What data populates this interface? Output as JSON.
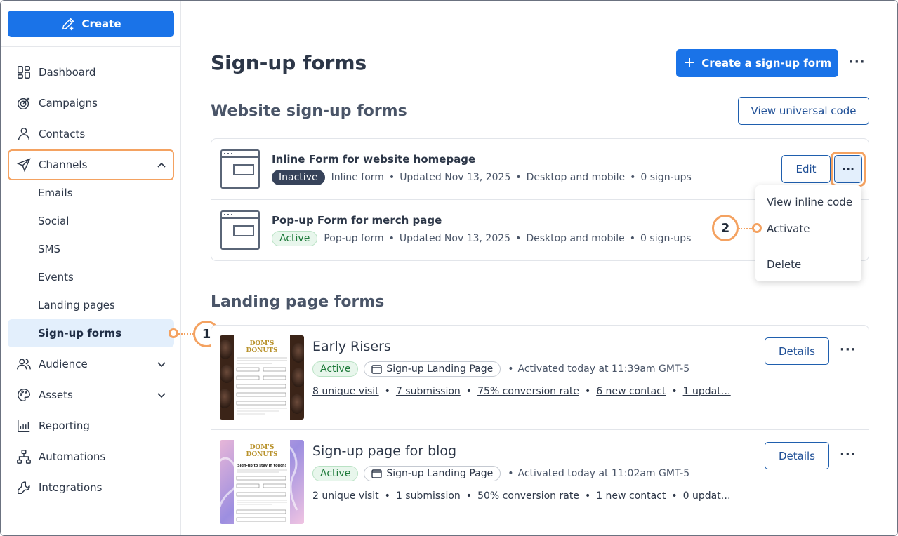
{
  "sidebar": {
    "create_label": "Create",
    "items": [
      {
        "label": "Dashboard",
        "icon": "dashboard-icon"
      },
      {
        "label": "Campaigns",
        "icon": "target-icon"
      },
      {
        "label": "Contacts",
        "icon": "person-icon"
      },
      {
        "label": "Channels",
        "icon": "paper-plane-icon"
      },
      {
        "label": "Audience",
        "icon": "people-icon"
      },
      {
        "label": "Assets",
        "icon": "palette-icon"
      },
      {
        "label": "Reporting",
        "icon": "chart-icon"
      },
      {
        "label": "Automations",
        "icon": "flow-icon"
      },
      {
        "label": "Integrations",
        "icon": "wrench-icon"
      }
    ],
    "channel_subitems": [
      "Emails",
      "Social",
      "SMS",
      "Events",
      "Landing pages",
      "Sign-up forms"
    ]
  },
  "callouts": {
    "one": "1",
    "two": "2"
  },
  "header": {
    "title": "Sign-up forms",
    "create_button": "Create a sign-up form",
    "more": "···"
  },
  "website_section": {
    "title": "Website sign-up forms",
    "universal_button": "View universal code",
    "forms": [
      {
        "title": "Inline Form for website homepage",
        "status": "Inactive",
        "type": "Inline form",
        "updated": "Updated Nov 13, 2025",
        "devices": "Desktop and mobile",
        "signups": "0 sign-ups"
      },
      {
        "title": "Pop-up Form for merch page",
        "status": "Active",
        "type": "Pop-up form",
        "updated": "Updated Nov 13, 2025",
        "devices": "Desktop and mobile",
        "signups": "0 sign-ups"
      }
    ],
    "edit_button": "Edit",
    "menu": [
      "View inline code",
      "Activate",
      "Delete"
    ]
  },
  "landing_section": {
    "title": "Landing page forms",
    "details_button": "Details",
    "pages": [
      {
        "title": "Early Risers",
        "status": "Active",
        "type": "Sign-up Landing Page",
        "activated": "Activated today at 11:39am GMT-5",
        "stats": [
          "8 unique visit",
          "7 submission",
          "75% conversion rate",
          "6 new contact",
          "1 updat…"
        ],
        "thumb_brand": "DOM'S DONUTS"
      },
      {
        "title": "Sign-up page for blog",
        "status": "Active",
        "type": "Sign-up Landing Page",
        "activated": "Activated today at 11:02am GMT-5",
        "stats": [
          "2 unique visit",
          "1 submission",
          "50% conversion rate",
          "1 new contact",
          "0 updat…"
        ],
        "thumb_brand": "DOM'S DONUTS",
        "thumb_heading": "Sign-up to stay in touch!"
      }
    ]
  },
  "colors": {
    "primary": "#1a73e8",
    "callout": "#f4a261",
    "active_green": "#1e7a3a",
    "inactive_dark": "#37435a"
  }
}
